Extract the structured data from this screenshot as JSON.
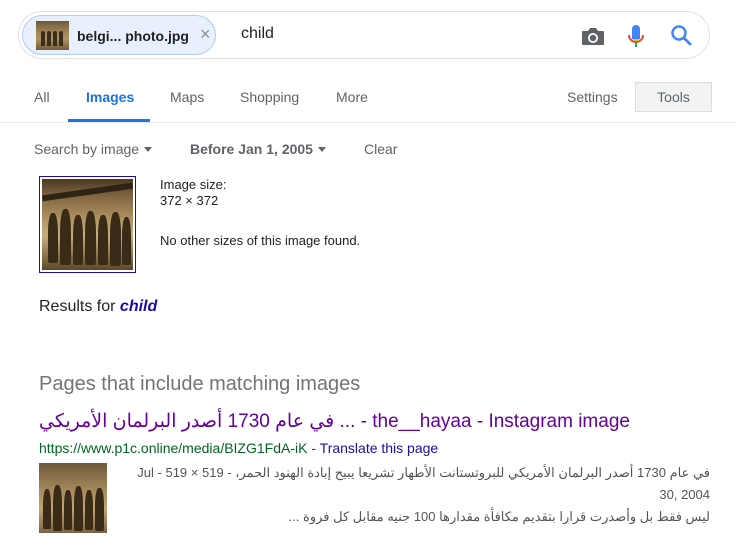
{
  "search": {
    "chip_label": "belgi... photo.jpg",
    "chip_close": "×",
    "query": "child"
  },
  "icons": [
    "camera-icon",
    "mic-icon",
    "search-icon"
  ],
  "tabs": [
    {
      "label": "All"
    },
    {
      "label": "Images",
      "active": true
    },
    {
      "label": "Maps"
    },
    {
      "label": "Shopping"
    },
    {
      "label": "More"
    }
  ],
  "settings_label": "Settings",
  "tools_label": "Tools",
  "filters": {
    "search_by": "Search by image",
    "date": "Before Jan 1, 2005",
    "clear": "Clear"
  },
  "image_info": {
    "size_label": "Image size:",
    "size_value": "372 × 372",
    "no_other_sizes": "No other sizes of this image found."
  },
  "results_for": {
    "prefix": "Results for",
    "term": "child"
  },
  "pages_heading": "Pages that include matching images",
  "result": {
    "title": "في عام 1730 أصدر البرلمان الأمريكي ... - the__hayaa - Instagram image",
    "url": "https://www.p1c.online/media/BIZG1FdA-iK",
    "translate": "Translate this page",
    "snippet_line1": "في عام 1730 أصدر البرلمان الأمريكي للبروتستانت الأطهار تشريعا يبيح إبادة الهنود الحمر، - 519 × 519 - Jul 30, 2004",
    "snippet_line2": "ليس فقط بل وأصدرت قرارا بتقديم مكافأة مقدارها 100 جنيه مقابل كل فروة ..."
  },
  "colors": {
    "link_blue": "#1a0dab",
    "accent_blue": "#1a73e8",
    "visited": "#660099",
    "url_green": "#006621"
  }
}
